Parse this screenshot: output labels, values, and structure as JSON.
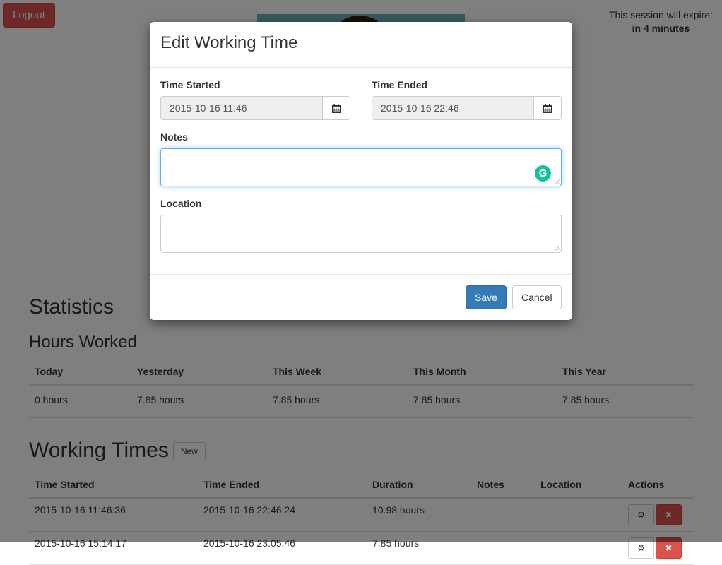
{
  "header": {
    "logout_label": "Logout",
    "session_line1": "This session will expire:",
    "session_line2": "in 4 minutes"
  },
  "statistics": {
    "title": "Statistics",
    "subtitle": "Hours Worked",
    "columns": [
      "Today",
      "Yesterday",
      "This Week",
      "This Month",
      "This Year"
    ],
    "values": [
      "0 hours",
      "7.85 hours",
      "7.85 hours",
      "7.85 hours",
      "7.85 hours"
    ]
  },
  "working_times": {
    "title": "Working Times",
    "new_label": "New",
    "columns": [
      "Time Started",
      "Time Ended",
      "Duration",
      "Notes",
      "Location",
      "Actions"
    ],
    "rows": [
      {
        "started": "2015-10-16 11:46:36",
        "ended": "2015-10-16 22:46:24",
        "duration": "10.98 hours",
        "notes": "",
        "location": ""
      },
      {
        "started": "2015-10-16 15:14:17",
        "ended": "2015-10-16 23:05:46",
        "duration": "7.85 hours",
        "notes": "",
        "location": ""
      }
    ]
  },
  "modal": {
    "title": "Edit Working Time",
    "time_started_label": "Time Started",
    "time_started_value": "2015-10-16 11:46",
    "time_ended_label": "Time Ended",
    "time_ended_value": "2015-10-16 22:46",
    "notes_label": "Notes",
    "notes_value": "",
    "location_label": "Location",
    "location_value": "",
    "save_label": "Save",
    "cancel_label": "Cancel"
  },
  "colors": {
    "primary": "#337ab7",
    "danger": "#d9534f",
    "grammarly": "#15c39a"
  }
}
